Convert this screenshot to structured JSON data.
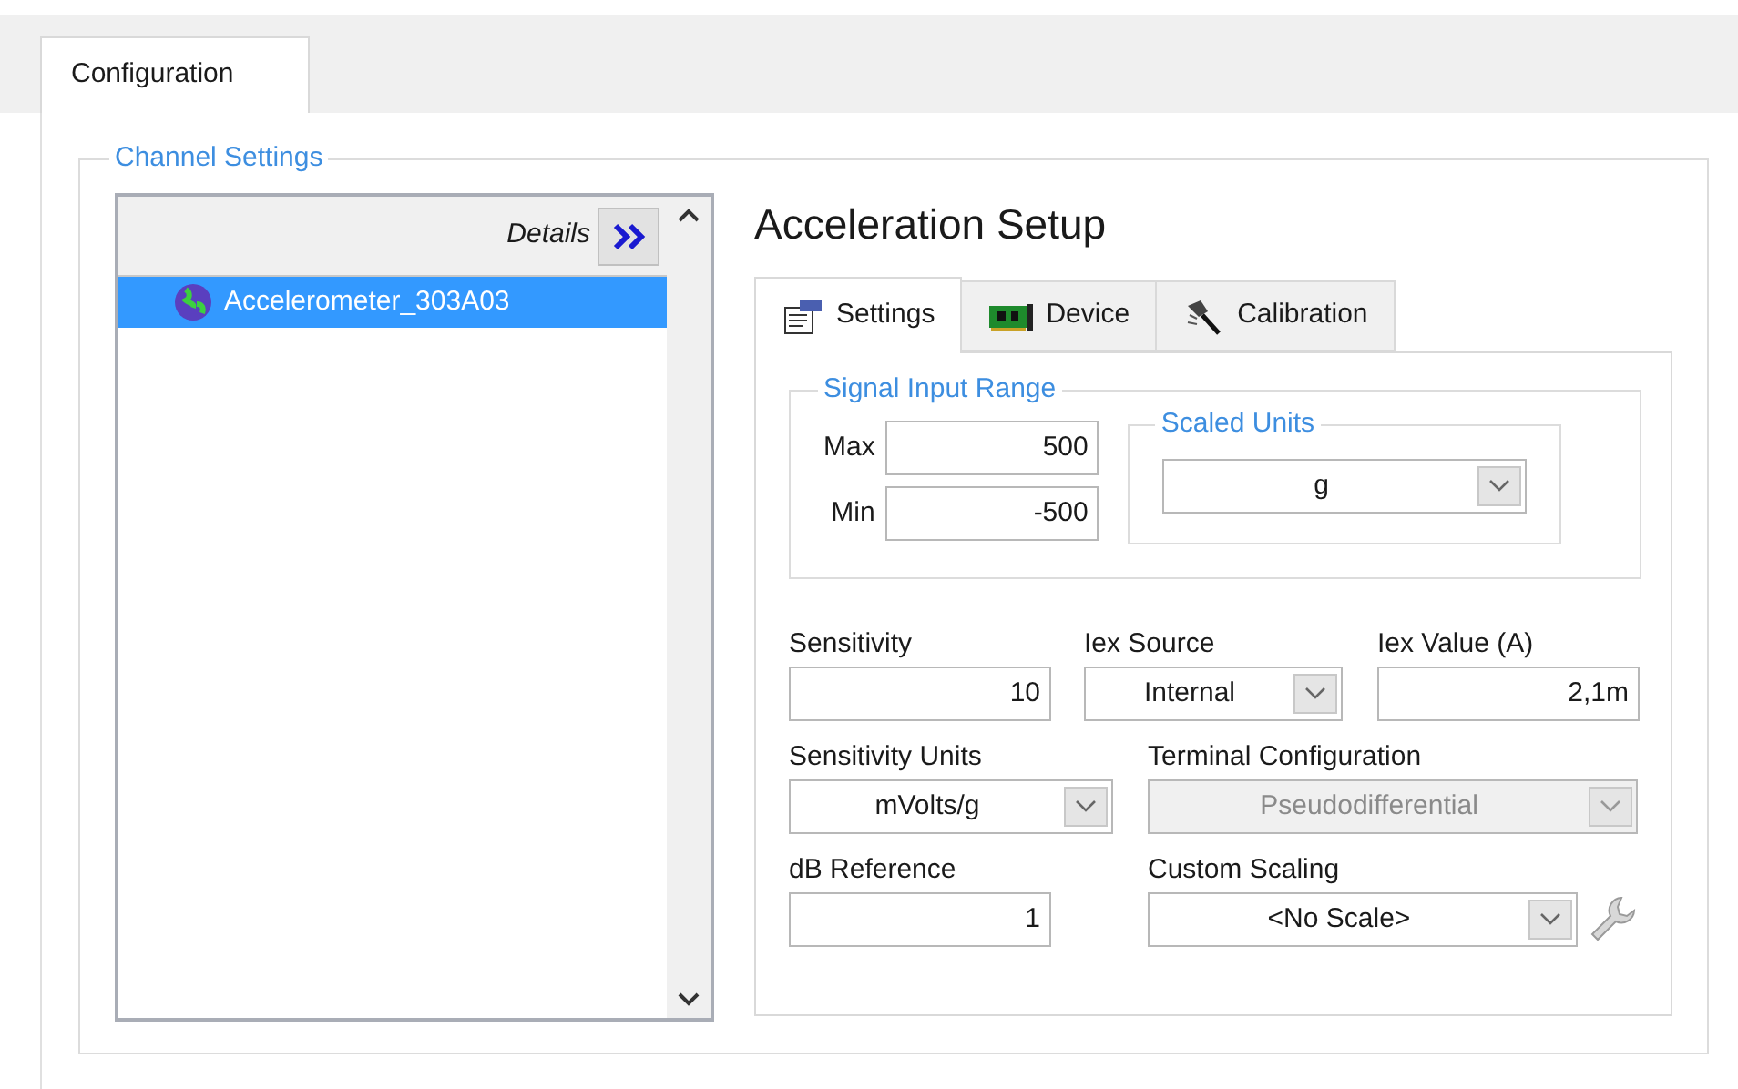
{
  "main_tabs": [
    {
      "label": "Configuration",
      "selected": true
    }
  ],
  "channel_settings": {
    "title": "Channel Settings",
    "details_label": "Details",
    "channels": [
      {
        "name": "Accelerometer_303A03",
        "selected": true
      }
    ]
  },
  "setup": {
    "title": "Acceleration Setup",
    "tabs": [
      {
        "label": "Settings",
        "selected": true
      },
      {
        "label": "Device",
        "selected": false
      },
      {
        "label": "Calibration",
        "selected": false
      }
    ],
    "signal_input_range": {
      "title": "Signal Input Range",
      "max": {
        "label": "Max",
        "value": "500"
      },
      "min": {
        "label": "Min",
        "value": "-500"
      }
    },
    "scaled_units": {
      "title": "Scaled Units",
      "value": "g"
    },
    "rows": [
      {
        "fields": [
          {
            "kind": "number",
            "label": "Sensitivity",
            "value": "10",
            "disabled": false
          },
          {
            "kind": "dropdown",
            "label": "Iex Source",
            "value": "Internal",
            "disabled": false
          },
          {
            "kind": "number",
            "label": "Iex Value (A)",
            "value": "2,1m",
            "disabled": false
          }
        ]
      },
      {
        "fields": [
          {
            "kind": "dropdown",
            "label": "Sensitivity Units",
            "value": "mVolts/g",
            "disabled": false
          },
          {
            "kind": "dropdown",
            "label": "Terminal Configuration",
            "value": "Pseudodifferential",
            "disabled": true
          }
        ]
      },
      {
        "fields": [
          {
            "kind": "number",
            "label": "dB Reference",
            "value": "1",
            "disabled": false
          },
          {
            "kind": "scale_picker",
            "label": "Custom Scaling",
            "value": "<No Scale>",
            "disabled": false
          }
        ]
      }
    ]
  }
}
